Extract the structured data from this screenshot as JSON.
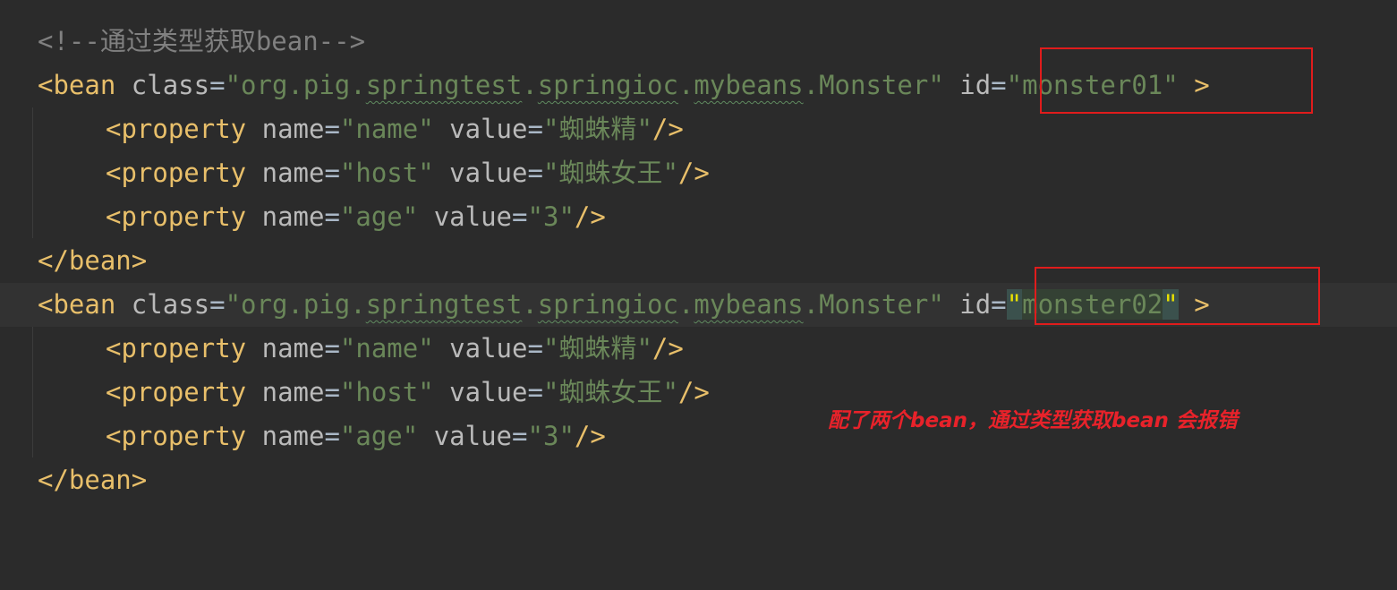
{
  "comment_line": "<!--通过类型获取bean-->",
  "bean1": {
    "open_tag": "<bean",
    "class_attr": "class",
    "eq": "=",
    "q": "\"",
    "class_pkg_a": "org.pig.",
    "class_pkg_b": "springtest",
    "class_dot1": ".",
    "class_pkg_c": "springioc",
    "class_dot2": ".",
    "class_pkg_d": "mybeans",
    "class_pkg_e": ".Monster",
    "id_attr": "id",
    "id_value": "monster01",
    "close": ">",
    "properties": [
      {
        "tag": "<property",
        "name_attr": "name",
        "name_value": "name",
        "value_attr": "value",
        "value": "蜘蛛精",
        "end": "/>"
      },
      {
        "tag": "<property",
        "name_attr": "name",
        "name_value": "host",
        "value_attr": "value",
        "value": "蜘蛛女王",
        "end": "/>"
      },
      {
        "tag": "<property",
        "name_attr": "name",
        "name_value": "age",
        "value_attr": "value",
        "value": "3",
        "end": "/>"
      }
    ],
    "end_tag": "</bean>"
  },
  "bean2": {
    "open_tag": "<bean",
    "class_attr": "class",
    "eq": "=",
    "q": "\"",
    "class_pkg_a": "org.pig.",
    "class_pkg_b": "springtest",
    "class_dot1": ".",
    "class_pkg_c": "springioc",
    "class_dot2": ".",
    "class_pkg_d": "mybeans",
    "class_pkg_e": ".Monster",
    "id_attr": "id",
    "id_value": "monster02",
    "close": ">",
    "properties": [
      {
        "tag": "<property",
        "name_attr": "name",
        "name_value": "name",
        "value_attr": "value",
        "value": "蜘蛛精",
        "end": "/>"
      },
      {
        "tag": "<property",
        "name_attr": "name",
        "name_value": "host",
        "value_attr": "value",
        "value": "蜘蛛女王",
        "end": "/>"
      },
      {
        "tag": "<property",
        "name_attr": "name",
        "name_value": "age",
        "value_attr": "value",
        "value": "3",
        "end": "/>"
      }
    ],
    "end_tag": "</bean>"
  },
  "annotation": "配了两个bean，通过类型获取bean 会报错",
  "colors": {
    "background": "#2b2b2b",
    "tag": "#e8bf6a",
    "attribute": "#bababa",
    "string": "#6a8759",
    "comment": "#808080",
    "highlight_box": "#e01c1c",
    "annotation": "#e8222a"
  }
}
